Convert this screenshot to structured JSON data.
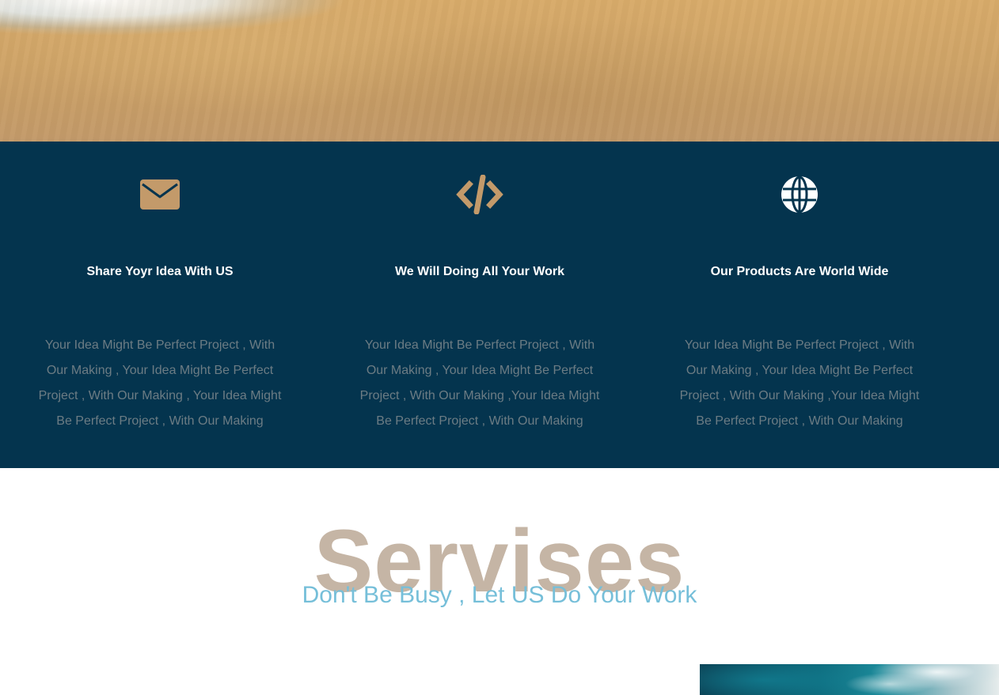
{
  "colors": {
    "features_bg": "#04344e",
    "icon_tan": "#c39a6a",
    "icon_white": "#ffffff",
    "feature_title": "#ffffff",
    "feature_text": "#6c7c84",
    "services_title": "#c5b5a5",
    "services_subtitle": "#76bfd9"
  },
  "features": [
    {
      "icon": "envelope-icon",
      "title": "Share Yoyr Idea With US",
      "text": "Your Idea Might Be Perfect Project , With Our Making , Your Idea Might Be Perfect Project , With Our Making , Your Idea Might Be Perfect Project , With Our Making"
    },
    {
      "icon": "code-icon",
      "title": "We Will Doing All Your Work",
      "text": "Your Idea Might Be Perfect Project , With Our Making , Your Idea Might Be Perfect Project , With Our Making ,Your Idea Might Be Perfect Project , With Our Making"
    },
    {
      "icon": "globe-icon",
      "title": "Our Products Are World Wide",
      "text": "Your Idea Might Be Perfect Project , With Our Making , Your Idea Might Be Perfect Project , With Our Making ,Your Idea Might Be Perfect Project , With Our Making"
    }
  ],
  "services": {
    "title": "Servises",
    "subtitle": "Don't Be Busy , Let US Do Your Work"
  }
}
